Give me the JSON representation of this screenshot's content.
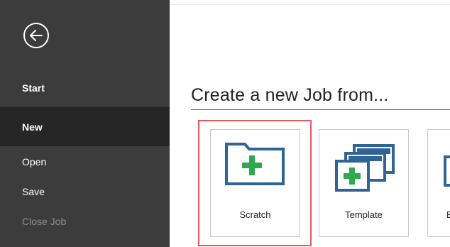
{
  "sidebar": {
    "back_icon": "back-arrow-circle-icon",
    "items": [
      {
        "label": "Start"
      },
      {
        "label": "New"
      },
      {
        "label": "Open"
      },
      {
        "label": "Save"
      },
      {
        "label": "Close Job"
      }
    ]
  },
  "main": {
    "heading": "Create a new Job from...",
    "tiles": [
      {
        "label": "Scratch",
        "icon": "new-folder-plus-icon"
      },
      {
        "label": "Template",
        "icon": "template-copy-plus-icon"
      },
      {
        "label": "E",
        "icon": "existing-job-icon"
      }
    ]
  },
  "colors": {
    "sidebar_bg": "#3c3c3c",
    "selected_bg": "#262626",
    "icon_blue": "#2e6496",
    "plus_green": "#2fa84f",
    "highlight_red": "#e05a60"
  }
}
